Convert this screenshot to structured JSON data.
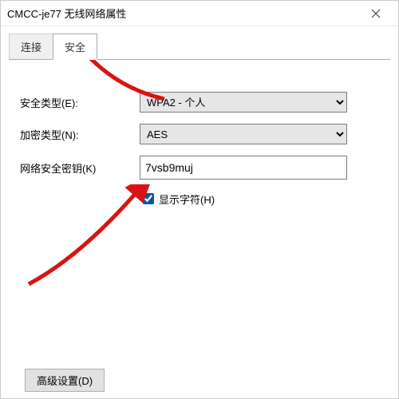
{
  "window": {
    "title": "CMCC-je77 无线网络属性"
  },
  "tabs": {
    "connection": "连接",
    "security": "安全"
  },
  "labels": {
    "security_type": "安全类型(E):",
    "encryption_type": "加密类型(N):",
    "network_key": "网络安全密钥(K)",
    "show_chars": "显示字符(H)",
    "advanced": "高级设置(D)"
  },
  "values": {
    "security_type": "WPA2 - 个人",
    "encryption_type": "AES",
    "network_key": "7vsb9muj"
  },
  "annotation": {
    "arrow_color": "#d91313"
  }
}
